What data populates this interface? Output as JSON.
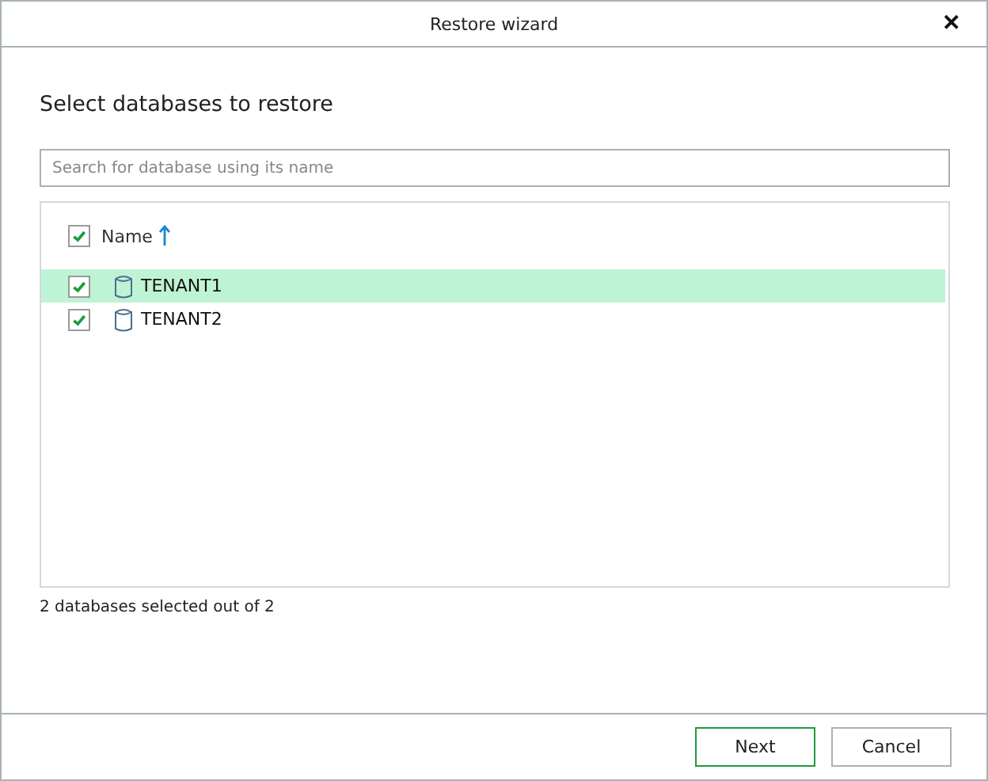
{
  "window": {
    "title": "Restore wizard",
    "close": "✕"
  },
  "heading": "Select databases to restore",
  "search": {
    "placeholder": "Search for database using its name"
  },
  "list_header": {
    "label": "Name",
    "checked": true,
    "sort_ascending": true
  },
  "rows": [
    {
      "name": "TENANT1",
      "checked": true,
      "selected": true
    },
    {
      "name": "TENANT2",
      "checked": true,
      "selected": false
    }
  ],
  "status": "2 databases selected out of 2",
  "buttons": [
    {
      "label": "Next",
      "kind": "primary"
    },
    {
      "label": "Cancel",
      "kind": "default"
    }
  ]
}
